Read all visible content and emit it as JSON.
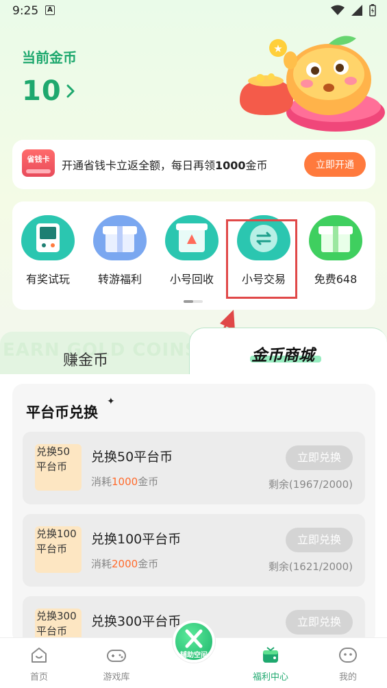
{
  "status_bar": {
    "time": "9:25"
  },
  "header": {
    "coin_label": "当前金币",
    "coin_value": "10"
  },
  "saver_card": {
    "badge": "省钱卡",
    "text_prefix": "开通省钱卡立返全额，每日再领",
    "text_amount": "1000",
    "text_suffix": "金币",
    "button": "立即开通"
  },
  "features": [
    {
      "label": "有奖试玩",
      "icon": "gamepad-icon",
      "color": "#2bc6b0"
    },
    {
      "label": "转游福利",
      "icon": "gift-box-icon",
      "color": "#7aa7f0"
    },
    {
      "label": "小号回收",
      "icon": "recycle-box-icon",
      "color": "#2bc6b0"
    },
    {
      "label": "小号交易",
      "icon": "exchange-coin-icon",
      "color": "#2bc6b0"
    },
    {
      "label": "免费648",
      "icon": "gift-box-icon",
      "color": "#3fcf5f"
    }
  ],
  "tabs": {
    "earn": "赚金币",
    "bg_text": "EARN GOLD COINS",
    "mall": "金币商城"
  },
  "panel": {
    "title": "平台币兑换",
    "items": [
      {
        "img_alt": "兑换50平台币",
        "title": "兑换50平台币",
        "cost_prefix": "消耗",
        "cost": "1000",
        "cost_suffix": "金币",
        "button": "立即兑换",
        "remain": "剩余(1967/2000)"
      },
      {
        "img_alt": "兑换100平台币",
        "title": "兑换100平台币",
        "cost_prefix": "消耗",
        "cost": "2000",
        "cost_suffix": "金币",
        "button": "立即兑换",
        "remain": "剩余(1621/2000)"
      },
      {
        "img_alt": "兑换300平台币",
        "title": "兑换300平台币",
        "cost_prefix": "",
        "cost": "",
        "cost_suffix": "",
        "button": "立即兑换",
        "remain": ""
      }
    ]
  },
  "nav": {
    "home": "首页",
    "games": "游戏库",
    "center": "辅助空间",
    "welfare": "福利中心",
    "mine": "我的"
  },
  "colors": {
    "accent": "#1ea86e",
    "orange": "#ff7a3d",
    "highlight": "#e04848"
  }
}
